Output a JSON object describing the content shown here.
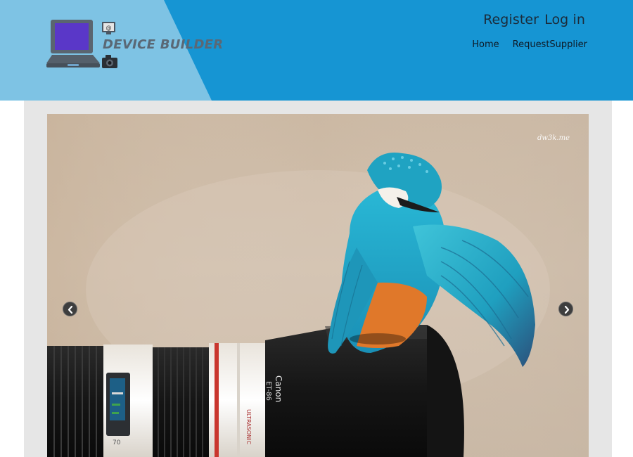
{
  "header": {
    "brand_name": "DEVICE BUILDER",
    "logo_icon": "laptop-camera-icon",
    "auth": {
      "register_label": "Register",
      "login_label": "Log in"
    },
    "nav": [
      {
        "label": "Home"
      },
      {
        "label": "RequestSupplier"
      }
    ],
    "colors": {
      "header_bg": "#1695d3",
      "header_light": "#7ec3e4"
    }
  },
  "slider": {
    "image": "kingfisher-on-camera-lens-photo",
    "watermark": "dw3k.me",
    "prev_icon": "chevron-left-icon",
    "next_icon": "chevron-right-icon"
  }
}
